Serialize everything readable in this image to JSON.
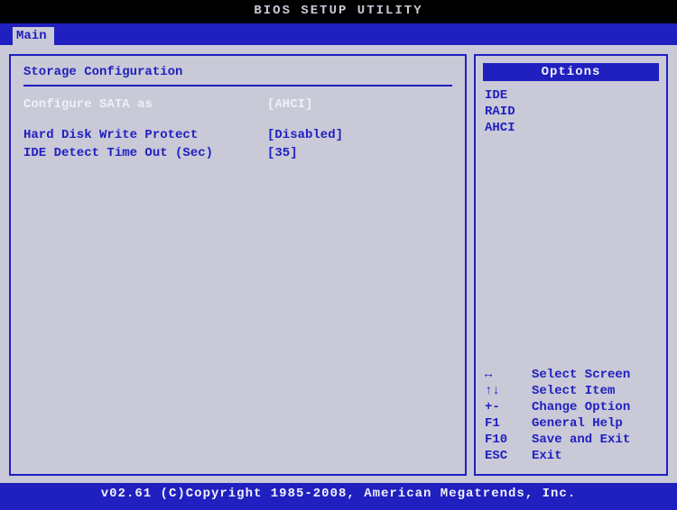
{
  "title": "BIOS SETUP UTILITY",
  "tab": "Main",
  "section_title": "Storage Configuration",
  "settings": {
    "sata": {
      "label": "Configure SATA as",
      "value": "[AHCI]"
    },
    "write_protect": {
      "label": "Hard Disk Write Protect",
      "value": "[Disabled]"
    },
    "ide_timeout": {
      "label": "IDE Detect Time Out (Sec)",
      "value": "[35]"
    }
  },
  "options": {
    "header": "Options",
    "items": [
      "IDE",
      "RAID",
      "AHCI"
    ]
  },
  "help": [
    {
      "key": "↔",
      "text": "Select Screen"
    },
    {
      "key": "↑↓",
      "text": "Select Item"
    },
    {
      "key": "+-",
      "text": "Change Option"
    },
    {
      "key": "F1",
      "text": "General Help"
    },
    {
      "key": "F10",
      "text": "Save and Exit"
    },
    {
      "key": "ESC",
      "text": "Exit"
    }
  ],
  "footer": "v02.61 (C)Copyright 1985-2008, American Megatrends, Inc."
}
